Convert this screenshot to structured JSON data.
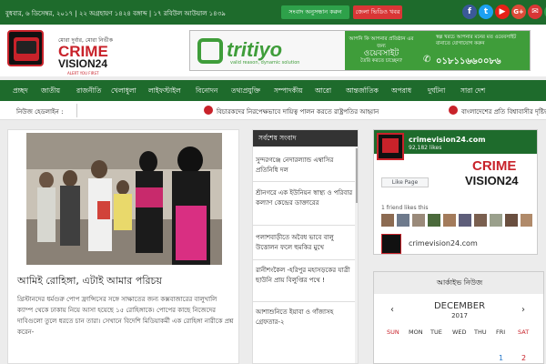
{
  "topbar": {
    "date_text": "বুধবার, ৬ ডিসেম্বর, ২০১৭ | ২২ অগ্রহায়ণ ১৪২৪ বঙ্গাব্দ | ১৭ রবিউল আউয়াল ১৪৩৯",
    "subscribe_label": "সংবাদ অনুসন্ধান করুন",
    "video_label": "জেলা ভিডিও খবর",
    "social_icons": [
      "facebook-icon",
      "twitter-icon",
      "youtube-icon",
      "google-plus-icon",
      "email-icon",
      "phone-icon"
    ]
  },
  "header": {
    "logo_tagline": "মোরা দুর্বার, মোরা নির্ভীক",
    "logo_line1": "CRIME",
    "logo_line2": "VISION24",
    "logo_line3": "ALERT YOU FIRST",
    "ad": {
      "brand": "tritiyo",
      "brand_tagline": "valid reason, dynamic solution",
      "mid_text_1": "আপনি কি আপনার প্রতিষ্ঠান এর জন্য",
      "mid_text_2": "ওয়েবসাইট",
      "mid_text_3": "তৈরি করতে চাচ্ছেন?",
      "right_text": "স্বল্প খরচে আপনার মনের মত ওয়েবসাইট বানাতে যোগাযোগ করুন",
      "phone": "০১৮১১৬৬০০৮৬"
    }
  },
  "nav": {
    "items": [
      "প্রচ্ছদ",
      "জাতীয়",
      "রাজনীতি",
      "খেলাধুলা",
      "লাইফস্টাইল",
      "বিনোদন",
      "তথ্যপ্রযুক্তি",
      "সম্পাদকীয়",
      "আরো",
      "আন্তর্জাতিক",
      "অপরাধ",
      "দুর্ঘটনা",
      "সারা দেশ"
    ]
  },
  "ticker": {
    "label": "নিউজ হেডলাইন :",
    "items": [
      "বিচারকদের নিরপেক্ষভাবে দায়িত্ব পালন করতে রাষ্ট্রপতির আহ্বান",
      "বাংলাদেশের প্রতি বিশ্বাবাসীর দৃষ্টিভঙ্গির পরিবর্তন"
    ]
  },
  "featured": {
    "title": "আমিই রোহিঙ্গা, এটাই আমার পরিচয়",
    "body": "খ্রিস্টানদের ধর্মগুরু পোপ ফ্রান্সিসের সঙ্গে সাক্ষাতের জন্য কক্সবাজারের বালুখালি ক্যাম্প থেকে ঢাকায় নিয়ে আসা হয়েছে ১৫ রোহিঙ্গাকে। পোপের কাছে নিজেদের দাবিগুলো তুলে ধরতে চান তারা। সেখানে বিদেশি মিডিয়াকর্মী এক রোহিঙ্গা নারীকে প্রশ্ন করেন-"
  },
  "latest": {
    "heading": "সর্বশেষ সংবাদ",
    "items": [
      "সুন্দরগঞ্জে নেদারল্যান্ড এম্বাসির প্রতিনিধি দল",
      "শ্রীনগরে এক ইউনিয়ন স্বাস্থ্য ও পরিবার কল্যাণ কেন্দ্রের ডাক্তারের",
      "পলাশবাড়ীতে অবৈধ ভাবে বালু উত্তোলন ফলে হুমকির মুখে",
      "রানীশংকৈল -হরিপুর মহাসড়কের যাত্রী ছাউনি প্রায় বিলুপ্তির পথে !",
      "আশাশুনিতে ইয়াবা ও গাঁজাসহ গ্রেফতার-২"
    ]
  },
  "fb_widget": {
    "page_name": "crimevision24.com",
    "likes": "92,182 likes",
    "like_button": "Like Page",
    "friends": "1 friend likes this",
    "post_name": "crimevision24.com"
  },
  "archive": {
    "heading": "আর্কাইভ নিউজ",
    "month": "DECEMBER",
    "year": "2017",
    "prev": "‹",
    "next": "›",
    "days_of_week": [
      "SUN",
      "MON",
      "TUE",
      "WED",
      "THU",
      "FRI",
      "SAT"
    ],
    "first_row": [
      "",
      "",
      "",
      "",
      "",
      "1",
      "2"
    ]
  }
}
